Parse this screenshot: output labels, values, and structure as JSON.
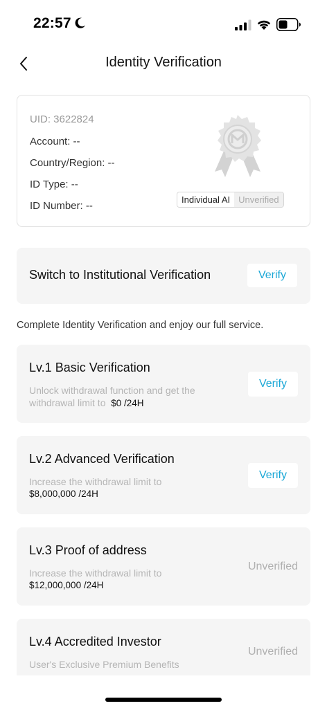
{
  "status_bar": {
    "time": "22:57"
  },
  "header": {
    "title": "Identity Verification"
  },
  "info": {
    "uid": "UID: 3622824",
    "account": "Account: --",
    "country": "Country/Region: --",
    "id_type": "ID Type: --",
    "id_number": "ID Number: --",
    "tag_type": "Individual AI",
    "tag_status": "Unverified"
  },
  "switch": {
    "title": "Switch to Institutional Verification",
    "button": "Verify"
  },
  "description": "Complete Identity Verification and enjoy our full service.",
  "levels": [
    {
      "title": "Lv.1 Basic Verification",
      "sub_line1": "Unlock withdrawal function and get the",
      "sub_line2": "withdrawal limit to",
      "amount": "$0 /24H",
      "action": "Verify"
    },
    {
      "title": "Lv.2 Advanced Verification",
      "sub_line1": "Increase the withdrawal limit to",
      "amount": "$8,000,000 /24H",
      "action": "Verify"
    },
    {
      "title": "Lv.3 Proof of address",
      "sub_line1": "Increase the withdrawal limit to",
      "amount": "$12,000,000 /24H",
      "status": "Unverified"
    },
    {
      "title": "Lv.4 Accredited Investor",
      "sub_line1": "User's Exclusive Premium Benefits",
      "status": "Unverified"
    }
  ],
  "colors": {
    "accent": "#1aa7d6",
    "card_bg": "#f5f5f5",
    "muted": "#b0b0b0"
  },
  "icons": [
    "moon-icon",
    "signal-icon",
    "wifi-icon",
    "battery-icon",
    "back-arrow-icon",
    "verification-badge-icon"
  ]
}
